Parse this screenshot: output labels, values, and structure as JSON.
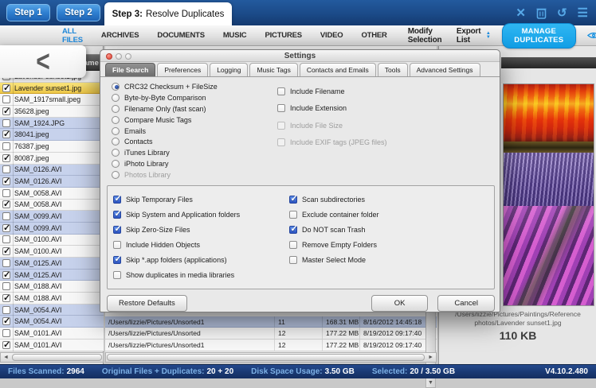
{
  "topbar": {
    "steps": [
      {
        "label": "Step 1"
      },
      {
        "label": "Step 2"
      }
    ],
    "active_step": {
      "prefix": "Step 3:",
      "label": "Resolve Duplicates"
    },
    "icons": {
      "close": "✕",
      "undo": "↺",
      "menu": "☰"
    }
  },
  "filterbar": {
    "filters": [
      {
        "label": "ALL FILES",
        "active": true
      },
      {
        "label": "ARCHIVES"
      },
      {
        "label": "DOCUMENTS"
      },
      {
        "label": "MUSIC"
      },
      {
        "label": "PICTURES"
      },
      {
        "label": "VIDEO"
      },
      {
        "label": "OTHER"
      }
    ],
    "modify_selection": "Modify Selection",
    "export_list": "Export List",
    "manage_duplicates": "MANAGE DUPLICATES"
  },
  "file_list": {
    "header": "Name",
    "rows": [
      {
        "name": "Lavender sunset1.jpg",
        "checked": false,
        "color": "white"
      },
      {
        "name": "Lavender sunset1.jpg",
        "checked": true,
        "color": "white",
        "selected": true
      },
      {
        "name": "SAM_1917small.jpeg",
        "checked": false,
        "color": "white"
      },
      {
        "name": "35628.jpeg",
        "checked": true,
        "color": "white"
      },
      {
        "name": "SAM_1924.JPG",
        "checked": false,
        "color": "blue"
      },
      {
        "name": "38041.jpeg",
        "checked": true,
        "color": "blue"
      },
      {
        "name": "76387.jpeg",
        "checked": false,
        "color": "white"
      },
      {
        "name": "80087.jpeg",
        "checked": true,
        "color": "white"
      },
      {
        "name": "SAM_0126.AVI",
        "checked": false,
        "color": "blue"
      },
      {
        "name": "SAM_0126.AVI",
        "checked": true,
        "color": "blue"
      },
      {
        "name": "SAM_0058.AVI",
        "checked": false,
        "color": "white"
      },
      {
        "name": "SAM_0058.AVI",
        "checked": true,
        "color": "white"
      },
      {
        "name": "SAM_0099.AVI",
        "checked": false,
        "color": "blue"
      },
      {
        "name": "SAM_0099.AVI",
        "checked": true,
        "color": "blue"
      },
      {
        "name": "SAM_0100.AVI",
        "checked": false,
        "color": "white"
      },
      {
        "name": "SAM_0100.AVI",
        "checked": true,
        "color": "white"
      },
      {
        "name": "SAM_0125.AVI",
        "checked": false,
        "color": "blue"
      },
      {
        "name": "SAM_0125.AVI",
        "checked": true,
        "color": "blue"
      },
      {
        "name": "SAM_0188.AVI",
        "checked": false,
        "color": "white"
      },
      {
        "name": "SAM_0188.AVI",
        "checked": true,
        "color": "white"
      },
      {
        "name": "SAM_0054.AVI",
        "checked": false,
        "color": "blue"
      },
      {
        "name": "SAM_0054.AVI",
        "checked": true,
        "color": "blue"
      },
      {
        "name": "SAM_0101.AVI",
        "checked": false,
        "color": "white"
      },
      {
        "name": "SAM_0101.AVI",
        "checked": true,
        "color": "white"
      }
    ]
  },
  "detail_rows": [
    {
      "path": "/Users/lizzie/Pictures/Unsorted1",
      "count": "11",
      "size": "168.31 MB",
      "date": "8/16/2012 14:45:18",
      "color": "blue"
    },
    {
      "path": "/Users/lizzie/Pictures/Unsorted",
      "count": "12",
      "size": "177.22 MB",
      "date": "8/19/2012 09:17:40",
      "color": "white"
    },
    {
      "path": "/Users/lizzie/Pictures/Unsorted1",
      "count": "12",
      "size": "177.22 MB",
      "date": "8/19/2012 09:17:40",
      "color": "white"
    }
  ],
  "preview": {
    "path": "/Users/lizzie/Pictures/Paintings/Reference photos/Lavender sunset1.jpg",
    "size": "110 KB"
  },
  "dialog": {
    "title": "Settings",
    "tabs": [
      {
        "label": "File Search",
        "selected": true
      },
      {
        "label": "Preferences"
      },
      {
        "label": "Logging"
      },
      {
        "label": "Music Tags"
      },
      {
        "label": "Contacts and Emails"
      },
      {
        "label": "Tools"
      },
      {
        "label": "Advanced Settings"
      }
    ],
    "radios": [
      {
        "label": "CRC32 Checksum + FileSize",
        "selected": true
      },
      {
        "label": "Byte-by-Byte Comparison"
      },
      {
        "label": "Filename Only (fast scan)"
      },
      {
        "label": "Compare Music Tags"
      },
      {
        "label": "Emails"
      },
      {
        "label": "Contacts"
      },
      {
        "label": "iTunes Library"
      },
      {
        "label": "iPhoto Library"
      },
      {
        "label": "Photos Library",
        "disabled": true
      }
    ],
    "include_checks": [
      {
        "label": "Include Filename",
        "checked": false
      },
      {
        "label": "Include Extension",
        "checked": false
      },
      {
        "label": "Include File Size",
        "checked": false,
        "disabled": true
      },
      {
        "label": "Include EXIF tags (JPEG files)",
        "checked": false,
        "disabled": true
      }
    ],
    "scan_checks_left": [
      {
        "label": "Skip Temporary Files",
        "checked": true
      },
      {
        "label": "Skip System and Application folders",
        "checked": true
      },
      {
        "label": "Skip Zero-Size Files",
        "checked": true
      },
      {
        "label": "Include Hidden Objects",
        "checked": false
      },
      {
        "label": "Skip *.app folders (applications)",
        "checked": true
      },
      {
        "label": "Show duplicates in media libraries",
        "checked": false
      }
    ],
    "scan_checks_right": [
      {
        "label": "Scan subdirectories",
        "checked": true
      },
      {
        "label": "Exclude container folder",
        "checked": false
      },
      {
        "label": "Do NOT scan Trash",
        "checked": true
      },
      {
        "label": "Remove Empty Folders",
        "checked": false
      },
      {
        "label": "Master Select Mode",
        "checked": false
      }
    ],
    "buttons": {
      "restore": "Restore Defaults",
      "ok": "OK",
      "cancel": "Cancel"
    }
  },
  "statusbar": {
    "items": [
      {
        "label": "Files Scanned:",
        "value": "2964"
      },
      {
        "label": "Original Files + Duplicates:",
        "value": "20 + 20"
      },
      {
        "label": "Disk Space Usage:",
        "value": "3.50 GB"
      },
      {
        "label": "Selected:",
        "value": "20 / 3.50 GB"
      }
    ],
    "version": "V4.10.2.480"
  },
  "scroll_glyphs": {
    "left": "◄",
    "right": "►",
    "down": "▼"
  },
  "colors": {
    "accent_blue": "#1d86d8",
    "manage_cyan": "#14a5ec",
    "statusbar_navy": "#1a3a74",
    "selected_yellow": "#f0cd52"
  }
}
